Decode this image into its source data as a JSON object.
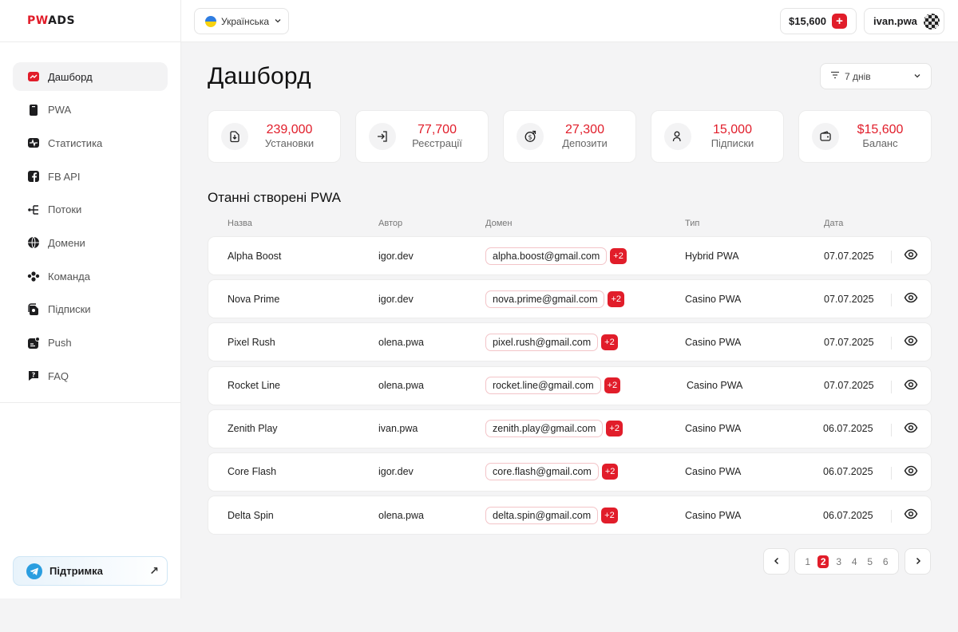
{
  "brand": {
    "part1": "PW",
    "part2": "ADS"
  },
  "sidebar": {
    "items": [
      {
        "label": "Дашборд",
        "icon": "dashboard-icon"
      },
      {
        "label": "PWA",
        "icon": "phone-icon"
      },
      {
        "label": "Статистика",
        "icon": "stats-icon"
      },
      {
        "label": "FB API",
        "icon": "facebook-icon"
      },
      {
        "label": "Потоки",
        "icon": "flows-icon"
      },
      {
        "label": "Домени",
        "icon": "globe-icon"
      },
      {
        "label": "Команда",
        "icon": "team-icon"
      },
      {
        "label": "Підписки",
        "icon": "subscriptions-icon"
      },
      {
        "label": "Push",
        "icon": "push-icon"
      },
      {
        "label": "FAQ",
        "icon": "faq-icon"
      }
    ],
    "support_label": "Підтримка"
  },
  "topbar": {
    "language": "Українська",
    "balance": "$15,600",
    "username": "ivan.pwa"
  },
  "main": {
    "title": "Дашборд",
    "period": "7 днів",
    "stats": [
      {
        "value": "239,000",
        "label": "Установки",
        "icon": "download-icon"
      },
      {
        "value": "77,700",
        "label": "Реєстрації",
        "icon": "login-icon"
      },
      {
        "value": "27,300",
        "label": "Депозити",
        "icon": "deposit-icon"
      },
      {
        "value": "15,000",
        "label": "Підписки",
        "icon": "user-icon"
      },
      {
        "value": "$15,600",
        "label": "Баланс",
        "icon": "wallet-icon"
      }
    ],
    "section_title": "Отанні створені PWA",
    "table": {
      "headers": {
        "name": "Назва",
        "author": "Автор",
        "domain": "Домен",
        "type": "Тип",
        "date": "Дата"
      },
      "rows": [
        {
          "name": "Alpha Boost",
          "author": "igor.dev",
          "domain": "alpha.boost@gmail.com",
          "extra": "+2",
          "type": "Hybrid PWA",
          "date": "07.07.2025"
        },
        {
          "name": "Nova Prime",
          "author": "igor.dev",
          "domain": "nova.prime@gmail.com",
          "extra": "+2",
          "type": "Casino PWA",
          "date": "07.07.2025"
        },
        {
          "name": "Pixel Rush",
          "author": "olena.pwa",
          "domain": "pixel.rush@gmail.com",
          "extra": "+2",
          "type": "Casino PWA",
          "date": "07.07.2025"
        },
        {
          "name": "Rocket Line",
          "author": "olena.pwa",
          "domain": "rocket.line@gmail.com",
          "extra": "+2",
          "type": "Casino PWA",
          "date": "07.07.2025"
        },
        {
          "name": "Zenith Play",
          "author": "ivan.pwa",
          "domain": "zenith.play@gmail.com",
          "extra": "+2",
          "type": "Casino PWA",
          "date": "06.07.2025"
        },
        {
          "name": "Core Flash",
          "author": "igor.dev",
          "domain": "core.flash@gmail.com",
          "extra": "+2",
          "type": "Casino PWA",
          "date": "06.07.2025"
        },
        {
          "name": "Delta Spin",
          "author": "olena.pwa",
          "domain": "delta.spin@gmail.com",
          "extra": "+2",
          "type": "Casino PWA",
          "date": "06.07.2025"
        }
      ]
    },
    "pagination": {
      "pages": [
        "1",
        "2",
        "3",
        "4",
        "5",
        "6"
      ],
      "current": "2"
    }
  },
  "colors": {
    "accent": "#e11d2a",
    "support": "#2a9ee0"
  }
}
